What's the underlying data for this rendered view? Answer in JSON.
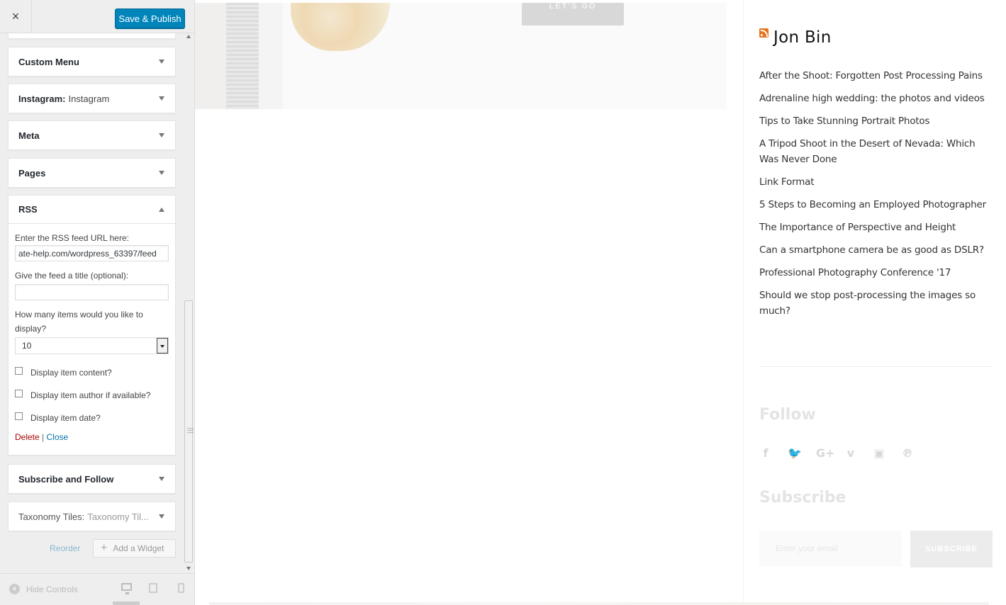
{
  "customizer": {
    "close_icon": "×",
    "publish_label": "Save & Publish",
    "widgets": [
      {
        "title": "Custom Menu",
        "subtitle": ""
      },
      {
        "title": "Instagram:",
        "subtitle": "Instagram"
      },
      {
        "title": "Meta",
        "subtitle": ""
      },
      {
        "title": "Pages",
        "subtitle": ""
      },
      {
        "title": "RSS",
        "subtitle": ""
      },
      {
        "title": "Subscribe and Follow",
        "subtitle": ""
      },
      {
        "title": "Taxonomy Tiles:",
        "subtitle": "Taxonomy Til..."
      }
    ],
    "rss_form": {
      "url_label": "Enter the RSS feed URL here:",
      "url_value": "ate-help.com/wordpress_63397/feed",
      "title_label": "Give the feed a title (optional):",
      "title_value": "",
      "items_label": "How many items would you like to display?",
      "items_value": "10",
      "checks": [
        {
          "label": "Display item content?",
          "checked": false
        },
        {
          "label": "Display item author if available?",
          "checked": false
        },
        {
          "label": "Display item date?",
          "checked": false
        }
      ],
      "delete_label": "Delete",
      "separator": "|",
      "close_label": "Close"
    },
    "reorder_label": "Reorder",
    "add_widget_label": "Add a Widget",
    "add_widget_icon": "+",
    "hide_controls_label": "Hide Controls"
  },
  "preview": {
    "lets_go_label": "LET'S GO",
    "rss_widget_title": "Jon Bin",
    "rss_items": [
      "After the Shoot: Forgotten Post Processing Pains",
      "Adrenaline high wedding: the photos and videos",
      "Tips to Take Stunning Portrait Photos",
      "A Tripod Shoot in the Desert of Nevada: Which Was Never Done",
      "Link Format",
      "5 Steps to Becoming an Employed Photographer",
      "The Importance of Perspective and Height",
      "Can a smartphone camera be as good as DSLR?",
      "Professional Photography Conference '17",
      "Should we stop post-processing the images so much?"
    ],
    "follow_heading": "Follow",
    "social_icons": [
      {
        "name": "facebook-icon",
        "glyph": "f"
      },
      {
        "name": "twitter-icon",
        "glyph": "🐦"
      },
      {
        "name": "google-plus-icon",
        "glyph": "G+"
      },
      {
        "name": "vimeo-icon",
        "glyph": "v"
      },
      {
        "name": "youtube-icon",
        "glyph": "▣"
      },
      {
        "name": "pinterest-icon",
        "glyph": "℗"
      }
    ],
    "subscribe_heading": "Subscribe",
    "email_placeholder": "Enter your email",
    "subscribe_label": "SUBSCRIBE"
  },
  "colors": {
    "publish_blue": "#0085ba",
    "delete_red": "#aa0000",
    "link_blue": "#0073aa",
    "rss_orange": "#e8731d"
  }
}
